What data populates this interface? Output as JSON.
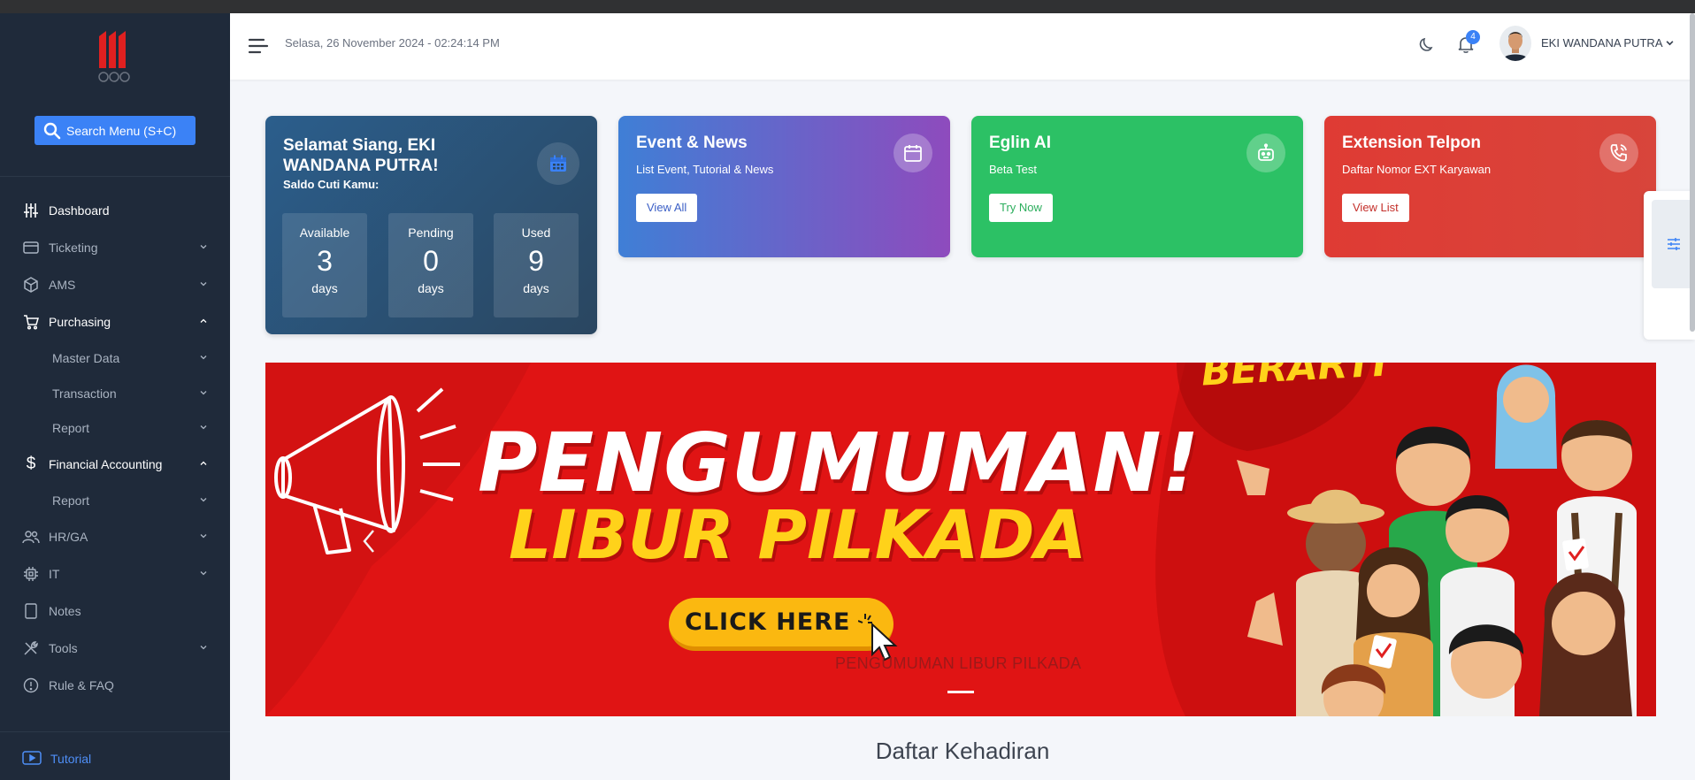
{
  "sidebar": {
    "search_label": "Search Menu (S+C)",
    "items": [
      {
        "label": "Dashboard",
        "icon": "sliders-icon"
      },
      {
        "label": "Ticketing",
        "icon": "card-icon"
      },
      {
        "label": "AMS",
        "icon": "box-icon"
      },
      {
        "label": "Purchasing",
        "icon": "cart-icon"
      },
      {
        "label": "Master Data"
      },
      {
        "label": "Transaction"
      },
      {
        "label": "Report"
      },
      {
        "label": "Financial Accounting",
        "icon": "dollar-icon"
      },
      {
        "label": "Report"
      },
      {
        "label": "HR/GA",
        "icon": "users-icon"
      },
      {
        "label": "IT",
        "icon": "cpu-icon"
      },
      {
        "label": "Notes",
        "icon": "note-icon"
      },
      {
        "label": "Tools",
        "icon": "tools-icon"
      },
      {
        "label": "Rule & FAQ",
        "icon": "info-icon"
      }
    ],
    "tutorial_label": "Tutorial"
  },
  "header": {
    "datetime": "Selasa, 26 November 2024 - 02:24:14 PM",
    "notification_count": "4",
    "username": "EKI WANDANA PUTRA"
  },
  "leave_card": {
    "greeting": "Selamat Siang, EKI WANDANA PUTRA!",
    "saldo_label": "Saldo Cuti Kamu:",
    "stats": [
      {
        "label": "Available",
        "value": "3",
        "unit": "days"
      },
      {
        "label": "Pending",
        "value": "0",
        "unit": "days"
      },
      {
        "label": "Used",
        "value": "9",
        "unit": "days"
      }
    ]
  },
  "cards": {
    "event": {
      "title": "Event & News",
      "subtitle": "List Event, Tutorial & News",
      "button": "View All"
    },
    "ai": {
      "title": "Eglin AI",
      "subtitle": "Beta Test",
      "button": "Try Now"
    },
    "ext": {
      "title": "Extension Telpon",
      "subtitle": "Daftar Nomor EXT Karyawan",
      "button": "View List"
    }
  },
  "banner": {
    "headline": "PENGUMUMAN!",
    "subline": "LIBUR PILKADA",
    "tag": "BERARTI",
    "cta": "CLICK HERE",
    "caption": "PENGUMUMAN LIBUR PILKADA"
  },
  "section_title": "Daftar Kehadiran",
  "colors": {
    "sidebar": "#1f2a3a",
    "accent": "#3b82f6",
    "event_card": "#6d63c9",
    "ai_card": "#2cc165",
    "ext_card": "#df3b34",
    "banner": "#e01414"
  }
}
